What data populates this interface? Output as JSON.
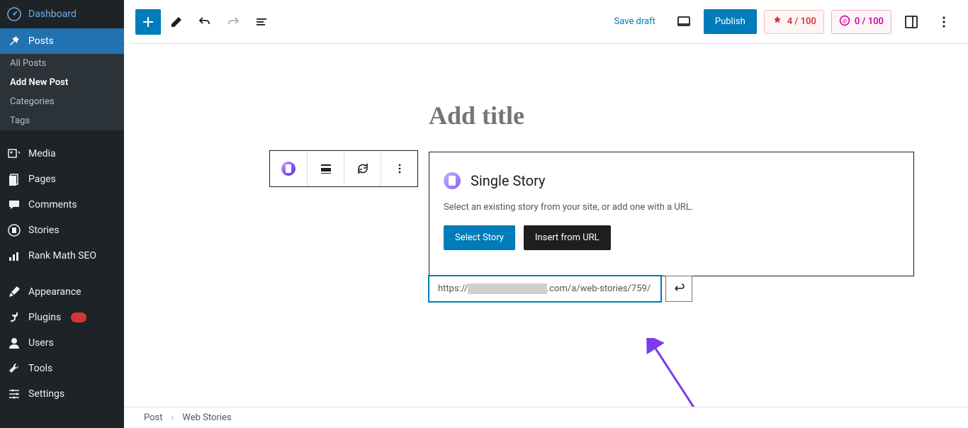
{
  "sidebar": {
    "dashboard": "Dashboard",
    "posts": "Posts",
    "sub": {
      "all": "All Posts",
      "add": "Add New Post",
      "cat": "Categories",
      "tags": "Tags"
    },
    "media": "Media",
    "pages": "Pages",
    "comments": "Comments",
    "stories": "Stories",
    "rankmath": "Rank Math SEO",
    "appearance": "Appearance",
    "plugins": "Plugins",
    "users": "Users",
    "tools": "Tools",
    "settings": "Settings"
  },
  "toolbar": {
    "saveDraft": "Save draft",
    "publish": "Publish",
    "score1": "4 / 100",
    "score2": "0 / 100"
  },
  "editor": {
    "titlePlaceholder": "Add title",
    "block": {
      "title": "Single Story",
      "desc": "Select an existing story from your site, or add one with a URL.",
      "selectBtn": "Select Story",
      "insertBtn": "Insert from URL"
    },
    "url": {
      "prefix": "https://",
      "suffix": ".com/a/web-stories/759/"
    }
  },
  "breadcrumb": {
    "root": "Post",
    "current": "Web Stories"
  }
}
